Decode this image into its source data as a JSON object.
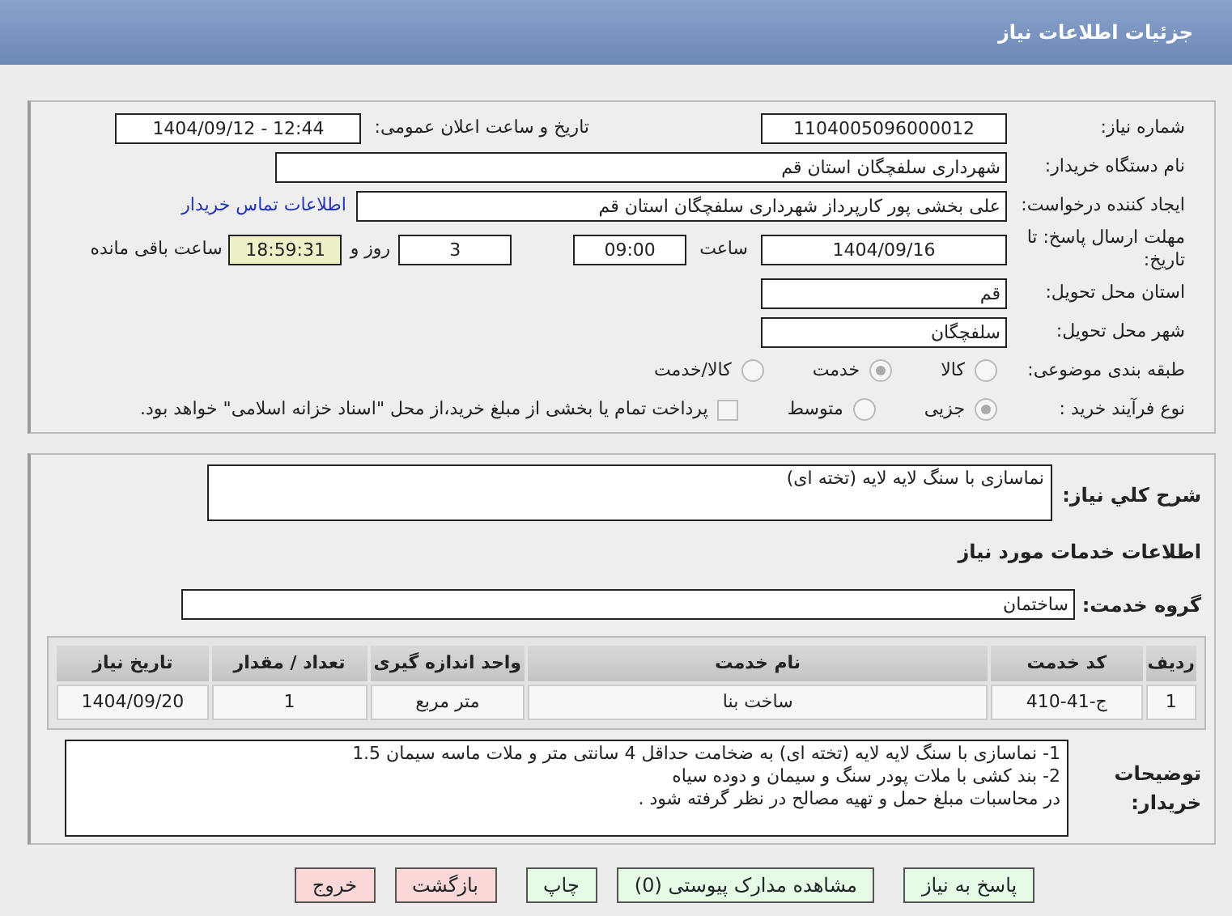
{
  "header": {
    "title": "جزئیات اطلاعات نیاز"
  },
  "need_number": {
    "label": "شماره نیاز:",
    "value": "1104005096000012"
  },
  "announce": {
    "label": "تاریخ و ساعت اعلان عمومی:",
    "value": "1404/09/12 - 12:44"
  },
  "buyer_name": {
    "label": "نام دستگاه خریدار:",
    "value": "شهرداری سلفچگان استان قم"
  },
  "creator": {
    "label": "ایجاد کننده درخواست:",
    "value": "علی  بخشی پور  کارپرداز شهرداری سلفچگان استان قم",
    "link": "اطلاعات تماس خریدار"
  },
  "deadline": {
    "label": "مهلت ارسال پاسخ: تا تاریخ:",
    "date": "1404/09/16",
    "time_label": "ساعت",
    "time": "09:00",
    "days": "3",
    "days_label": "روز و",
    "remaining": "18:59:31",
    "remaining_label": "ساعت باقی مانده"
  },
  "province": {
    "label": "استان محل تحویل:",
    "value": "قم"
  },
  "city": {
    "label": "شهر محل تحویل:",
    "value": "سلفچگان"
  },
  "category": {
    "label": "طبقه بندی موضوعی:",
    "options": [
      {
        "label": "کالا",
        "selected": false
      },
      {
        "label": "خدمت",
        "selected": true
      },
      {
        "label": "کالا/خدمت",
        "selected": false
      }
    ]
  },
  "purchase_type": {
    "label": "نوع فرآیند خرید :",
    "options": [
      {
        "label": "جزیی",
        "selected": true
      },
      {
        "label": "متوسط",
        "selected": false
      }
    ],
    "payment": {
      "label": "پرداخت تمام یا بخشی از مبلغ خرید،از محل \"اسناد خزانه اسلامی\" خواهد بود.",
      "checked": false
    }
  },
  "description": {
    "label": "شرح کلي نياز:",
    "value": "نماسازی با سنگ لایه لایه (تخته ای)"
  },
  "services_title": "اطلاعات خدمات مورد نیاز",
  "service_group": {
    "label": "گروه خدمت:",
    "value": "ساختمان"
  },
  "table": {
    "columns": [
      "ردیف",
      "کد خدمت",
      "نام خدمت",
      "واحد اندازه گیری",
      "تعداد / مقدار",
      "تاریخ نیاز"
    ],
    "rows": [
      [
        "1",
        "ج-41-410",
        "ساخت بنا",
        "متر مربع",
        "1",
        "1404/09/20"
      ]
    ]
  },
  "buyer_notes": {
    "label": "توضیحات خریدار:",
    "lines": [
      "1- نماسازی با سنگ لایه لایه (تخته ای) به ضخامت حداقل 4 سانتی متر و ملات ماسه سیمان 1.5",
      "2- بند کشی با ملات پودر سنگ و سیمان و دوده سیاه",
      "در محاسبات مبلغ حمل و تهیه مصالح در نظر گرفته شود ."
    ]
  },
  "buttons": [
    {
      "label": "پاسخ به نیاز",
      "kind": "action"
    },
    {
      "label": "مشاهده مدارک پیوستی (0)",
      "kind": "action"
    },
    {
      "label": "چاپ",
      "kind": "action"
    },
    {
      "label": "بازگشت",
      "kind": "exit"
    },
    {
      "label": "خروج",
      "kind": "exit"
    }
  ]
}
